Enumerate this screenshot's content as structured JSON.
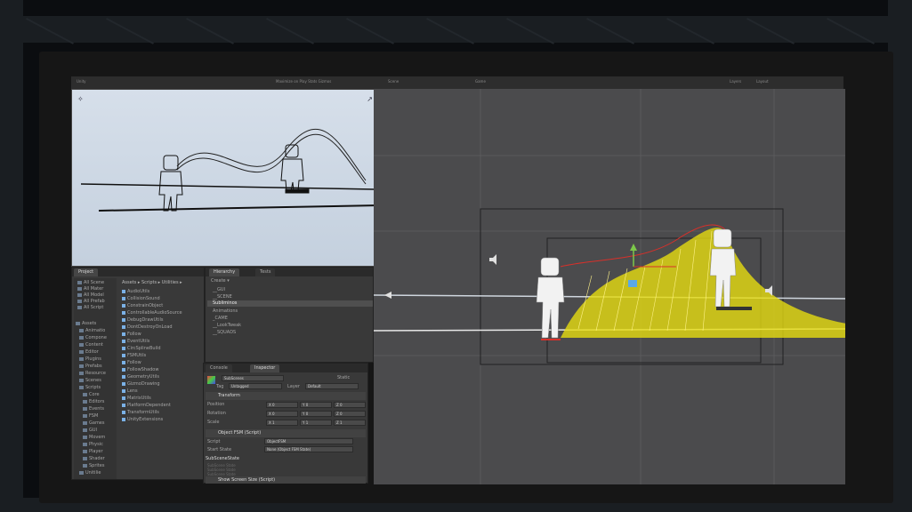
{
  "topbar": {
    "title": "Unity",
    "center_text": "Maximize on Play   Stats   Gizmos",
    "scene_tab": "Scene",
    "game_tab": "Game",
    "layers": "Layers",
    "layout": "Layout"
  },
  "game_view": {
    "gizmo_left": "✧",
    "gizmo_right": "↗"
  },
  "project": {
    "tab": "Project",
    "favorites": [
      "All Scene",
      "All Mater",
      "All Model",
      "All Prefab",
      "All Script"
    ],
    "tree": [
      "Assets",
      "Animatio",
      "Compone",
      "Content",
      "Editor",
      "Plugins",
      "Prefabs",
      "Resource",
      "Scenes",
      "Scripts",
      "Core",
      "Editors",
      "Events",
      "FSM",
      "Games",
      "GUI",
      "Movem",
      "Physic",
      "Player",
      "Shader",
      "Sprites",
      "Unitilie"
    ],
    "breadcrumb": "Assets ▸ Scripts ▸ Utilities ▸",
    "files": [
      "AudioUtils",
      "CollisionSound",
      "ConstrainObject",
      "ControllableAudioSource",
      "DebugDrawUtils",
      "DontDestroyOnLoad",
      "Follow",
      "EventUtils",
      "CircSplineBuild",
      "FSMUtils",
      "Follow",
      "FollowShadow",
      "GeometryUtils",
      "GizmoDrawing",
      "Lens",
      "MatrixUtils",
      "PlatformDependent",
      "TransformUtils",
      "UnityExtensions"
    ]
  },
  "hierarchy": {
    "tab": "Hierarchy",
    "tab2": "Tests",
    "create": "Create ▾",
    "items": [
      "__GUI",
      "__SCENE",
      "Subliminos",
      "Animations",
      "_CAME",
      "__LookTweak",
      "__SQUADS"
    ]
  },
  "console_tab": "Console",
  "inspector": {
    "tab": "Inspector",
    "object_name": "SubScenes",
    "static_label": "Static",
    "tag_label": "Tag",
    "tag_value": "Untagged",
    "layer_label": "Layer",
    "layer_value": "Default",
    "transform_title": "Transform",
    "rows": [
      {
        "label": "Position",
        "x": "X  0",
        "y": "Y  0",
        "z": "Z  0"
      },
      {
        "label": "Rotation",
        "x": "X  0",
        "y": "Y  0",
        "z": "Z  0"
      },
      {
        "label": "Scale",
        "x": "X  1",
        "y": "Y  1",
        "z": "Z  1"
      }
    ],
    "fsm_title": "Object FSM (Script)",
    "script_label": "Script",
    "script_value": "ObjectFSM",
    "start_state_label": "Start State",
    "start_state_value": "None (Object FSM State)",
    "subscene_title": "SubSceneState",
    "faded": [
      "SubScene State",
      "SubScene State",
      "SubScene State"
    ],
    "bottom_title": "Show Screen Size (Script)"
  },
  "colors": {
    "accent_yellow": "#e6dc10",
    "selection_red": "#d8302a",
    "scene_bg": "#4b4b4d",
    "panel_bg": "#393939",
    "gizmo_green": "#7cc84a"
  }
}
